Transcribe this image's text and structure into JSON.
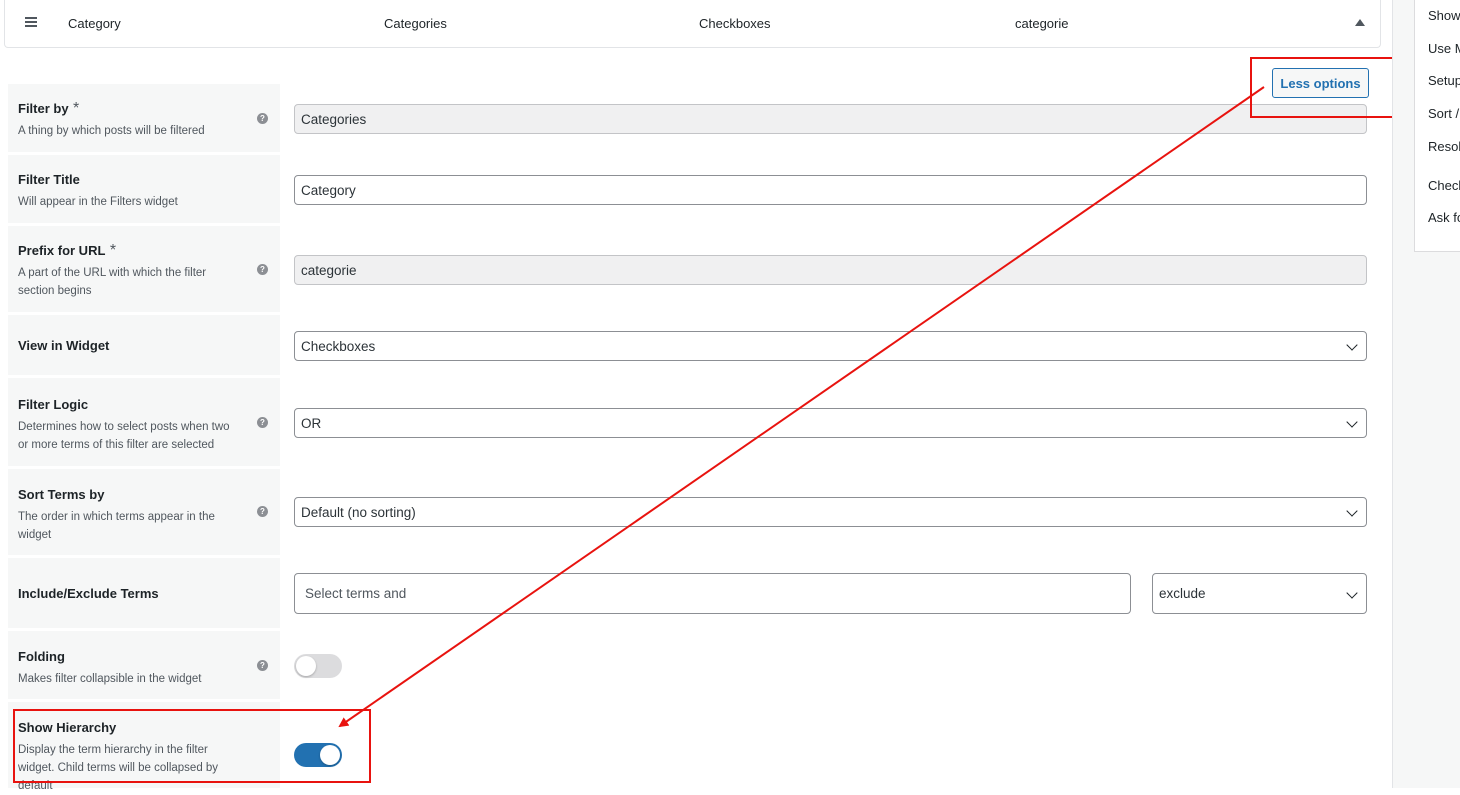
{
  "header": {
    "name": "Category",
    "filter_by": "Categories",
    "view": "Checkboxes",
    "url_prefix": "categorie"
  },
  "less_options_label": "Less options",
  "rows": {
    "filter_by": {
      "title": "Filter by",
      "required": "*",
      "desc": "A thing by which posts will be filtered",
      "value": "Categories"
    },
    "filter_title": {
      "title": "Filter Title",
      "desc": "Will appear in the Filters widget",
      "value": "Category"
    },
    "prefix": {
      "title": "Prefix for URL",
      "required": "*",
      "desc1": "A part of the URL with which the filter",
      "desc2": "section begins",
      "value": "categorie"
    },
    "view": {
      "title": "View in Widget",
      "value": "Checkboxes"
    },
    "logic": {
      "title": "Filter Logic",
      "desc1": "Determines how to select posts when two",
      "desc2": "or more terms of this filter are selected",
      "value": "OR"
    },
    "sort": {
      "title": "Sort Terms by",
      "desc1": "The order in which terms appear in the",
      "desc2": "widget",
      "value": "Default (no sorting)"
    },
    "include": {
      "title": "Include/Exclude Terms",
      "placeholder": "Select terms and",
      "mode": "exclude"
    },
    "folding": {
      "title": "Folding",
      "desc": "Makes filter collapsible in the widget",
      "enabled": false
    },
    "hierarchy": {
      "title": "Show Hierarchy",
      "desc1": "Display the term hierarchy in the filter",
      "desc2": "widget. Child terms will be collapsed by",
      "desc3": "default",
      "enabled": true
    }
  },
  "right_menu": [
    "Show",
    "Use M",
    "Setup",
    "Sort /",
    "Resolv",
    "Check",
    "Ask fo"
  ],
  "colors": {
    "annotation": "#e8130f",
    "accent": "#2271b1"
  }
}
